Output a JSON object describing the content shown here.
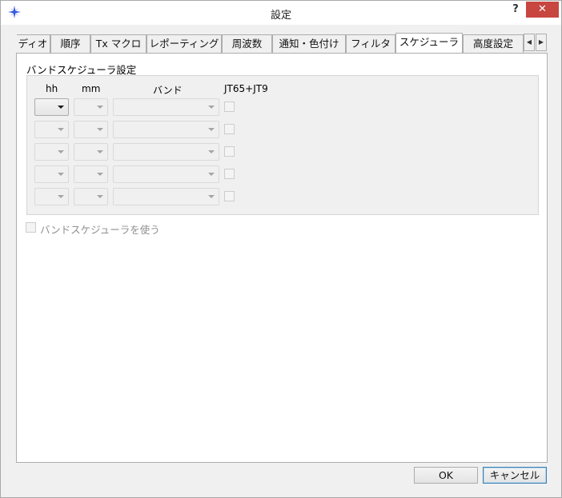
{
  "window": {
    "title": "設定",
    "help_label": "?",
    "close_label": "✕"
  },
  "tabs": [
    {
      "label": "ディオ"
    },
    {
      "label": "順序"
    },
    {
      "label": "Tx マクロ"
    },
    {
      "label": "レポーティング"
    },
    {
      "label": "周波数"
    },
    {
      "label": "通知・色付け"
    },
    {
      "label": "フィルタ"
    },
    {
      "label": "スケジューラ",
      "active": true
    },
    {
      "label": "高度設定"
    }
  ],
  "tab_scroll": {
    "left": "◀",
    "right": "▶"
  },
  "scheduler": {
    "group_title": "バンドスケジューラ設定",
    "columns": {
      "hh": "hh",
      "mm": "mm",
      "band": "バンド",
      "mode": "JT65+JT9"
    },
    "rows": [
      {
        "hh": "",
        "mm": "",
        "band": "",
        "jt65_jt9": false
      },
      {
        "hh": "",
        "mm": "",
        "band": "",
        "jt65_jt9": false
      },
      {
        "hh": "",
        "mm": "",
        "band": "",
        "jt65_jt9": false
      },
      {
        "hh": "",
        "mm": "",
        "band": "",
        "jt65_jt9": false
      },
      {
        "hh": "",
        "mm": "",
        "band": "",
        "jt65_jt9": false
      }
    ],
    "use_label": "バンドスケジューラを使う",
    "use_checked": false
  },
  "buttons": {
    "ok": "OK",
    "cancel": "キャンセル"
  },
  "colors": {
    "close": "#c7463f",
    "panel": "#ffffff",
    "window": "#f0f0f0"
  }
}
